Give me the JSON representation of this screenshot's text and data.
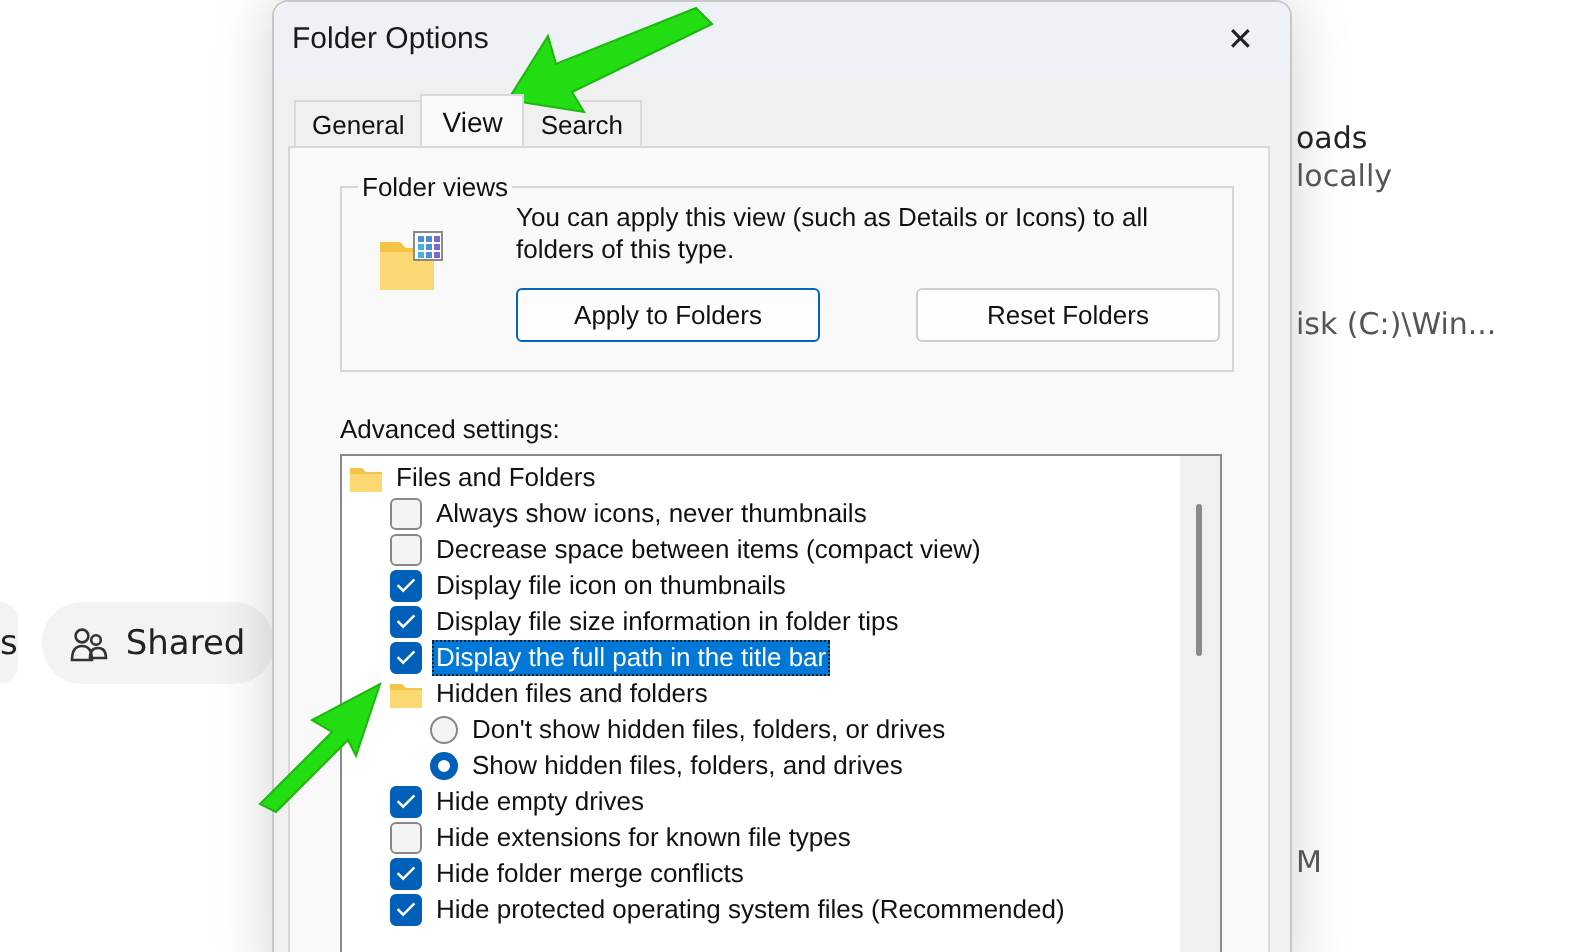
{
  "background": {
    "left_pills": [
      {
        "label": "s"
      },
      {
        "label": "Shared"
      }
    ],
    "right_texts": [
      "oads",
      "locally",
      "isk (C:)\\Win...",
      "M"
    ]
  },
  "window": {
    "title": "Folder Options",
    "close": "✕"
  },
  "tabs": [
    {
      "label": "General",
      "selected": false
    },
    {
      "label": "View",
      "selected": true
    },
    {
      "label": "Search",
      "selected": false
    }
  ],
  "folder_views": {
    "legend": "Folder views",
    "description": "You can apply this view (such as Details or Icons) to all folders of this type.",
    "buttons": [
      {
        "label": "Apply to Folders",
        "kind": "default"
      },
      {
        "label": "Reset Folders",
        "kind": "normal"
      }
    ]
  },
  "advanced": {
    "label": "Advanced settings:",
    "items": [
      {
        "kind": "folder",
        "label": "Files and Folders",
        "selected": false,
        "children": [
          {
            "kind": "checkbox",
            "label": "Always show icons, never thumbnails",
            "checked": false,
            "selected": false
          },
          {
            "kind": "checkbox",
            "label": "Decrease space between items (compact view)",
            "checked": false,
            "selected": false
          },
          {
            "kind": "checkbox",
            "label": "Display file icon on thumbnails",
            "checked": true,
            "selected": false
          },
          {
            "kind": "checkbox",
            "label": "Display file size information in folder tips",
            "checked": true,
            "selected": false
          },
          {
            "kind": "checkbox",
            "label": "Display the full path in the title bar",
            "checked": true,
            "selected": true
          },
          {
            "kind": "folder",
            "label": "Hidden files and folders",
            "selected": false,
            "children": [
              {
                "kind": "radio",
                "label": "Don't show hidden files, folders, or drives",
                "checked": false,
                "selected": false
              },
              {
                "kind": "radio",
                "label": "Show hidden files, folders, and drives",
                "checked": true,
                "selected": false
              }
            ]
          },
          {
            "kind": "checkbox",
            "label": "Hide empty drives",
            "checked": true,
            "selected": false
          },
          {
            "kind": "checkbox",
            "label": "Hide extensions for known file types",
            "checked": false,
            "selected": false
          },
          {
            "kind": "checkbox",
            "label": "Hide folder merge conflicts",
            "checked": true,
            "selected": false
          },
          {
            "kind": "checkbox",
            "label": "Hide protected operating system files (Recommended)",
            "checked": true,
            "selected": false
          }
        ]
      }
    ]
  },
  "annotations": [
    {
      "kind": "arrow"
    },
    {
      "kind": "arrow"
    }
  ]
}
